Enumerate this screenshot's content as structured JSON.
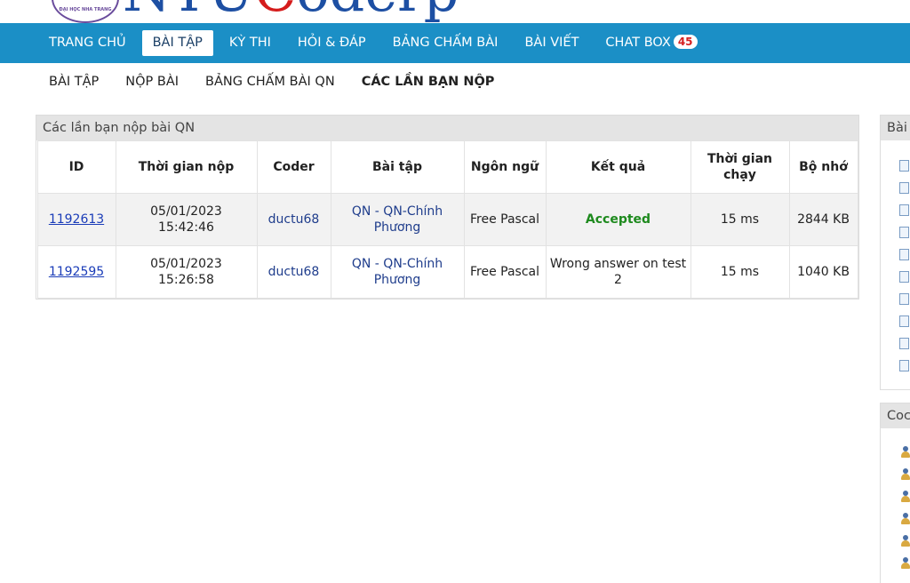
{
  "logo": {
    "text_blue": "NTU",
    "text_red": "C",
    "text_blue2": "oder",
    "text_tail": "p",
    "seal_text": "ĐẠI HỌC NHA TRANG"
  },
  "mainnav": {
    "items": [
      {
        "label": "TRANG CHỦ"
      },
      {
        "label": "BÀI TẬP"
      },
      {
        "label": "KỲ THI"
      },
      {
        "label": "HỎI & ĐÁP"
      },
      {
        "label": "BẢNG CHẤM BÀI"
      },
      {
        "label": "BÀI VIẾT"
      },
      {
        "label": "CHAT BOX"
      }
    ],
    "active_index": 1,
    "chat_badge": "45"
  },
  "subnav": {
    "items": [
      {
        "label": "BÀI TẬP"
      },
      {
        "label": "NỘP BÀI"
      },
      {
        "label": "BẢNG CHẤM BÀI QN"
      },
      {
        "label": "CÁC LẦN BẠN NỘP"
      }
    ]
  },
  "panel": {
    "title": "Các lần bạn nộp bài QN",
    "columns": [
      "ID",
      "Thời gian nộp",
      "Coder",
      "Bài tập",
      "Ngôn ngữ",
      "Kết quả",
      "Thời gian chạy",
      "Bộ nhớ"
    ],
    "rows": [
      {
        "id": "1192613",
        "date": "05/01/2023",
        "time": "15:42:46",
        "coder": "ductu68",
        "problem": "QN - QN-Chính Phương",
        "language": "Free Pascal",
        "result": "Accepted",
        "runtime": "15 ms",
        "memory": "2844 KB"
      },
      {
        "id": "1192595",
        "date": "05/01/2023",
        "time": "15:26:58",
        "coder": "ductu68",
        "problem": "QN - QN-Chính Phương",
        "language": "Free Pascal",
        "result": "Wrong answer on test 2",
        "runtime": "15 ms",
        "memory": "1040 KB"
      }
    ]
  },
  "sidebar": {
    "box1_title": "Bài",
    "box2_title": "Coc"
  },
  "colors": {
    "nav_bg": "#1b8fc6",
    "accepted": "#1e8a1e",
    "link": "#1a3cb8",
    "badge_text": "#d52020"
  },
  "icons": {
    "sidebar_doc": "document-icon",
    "sidebar_user": "user-icon"
  }
}
